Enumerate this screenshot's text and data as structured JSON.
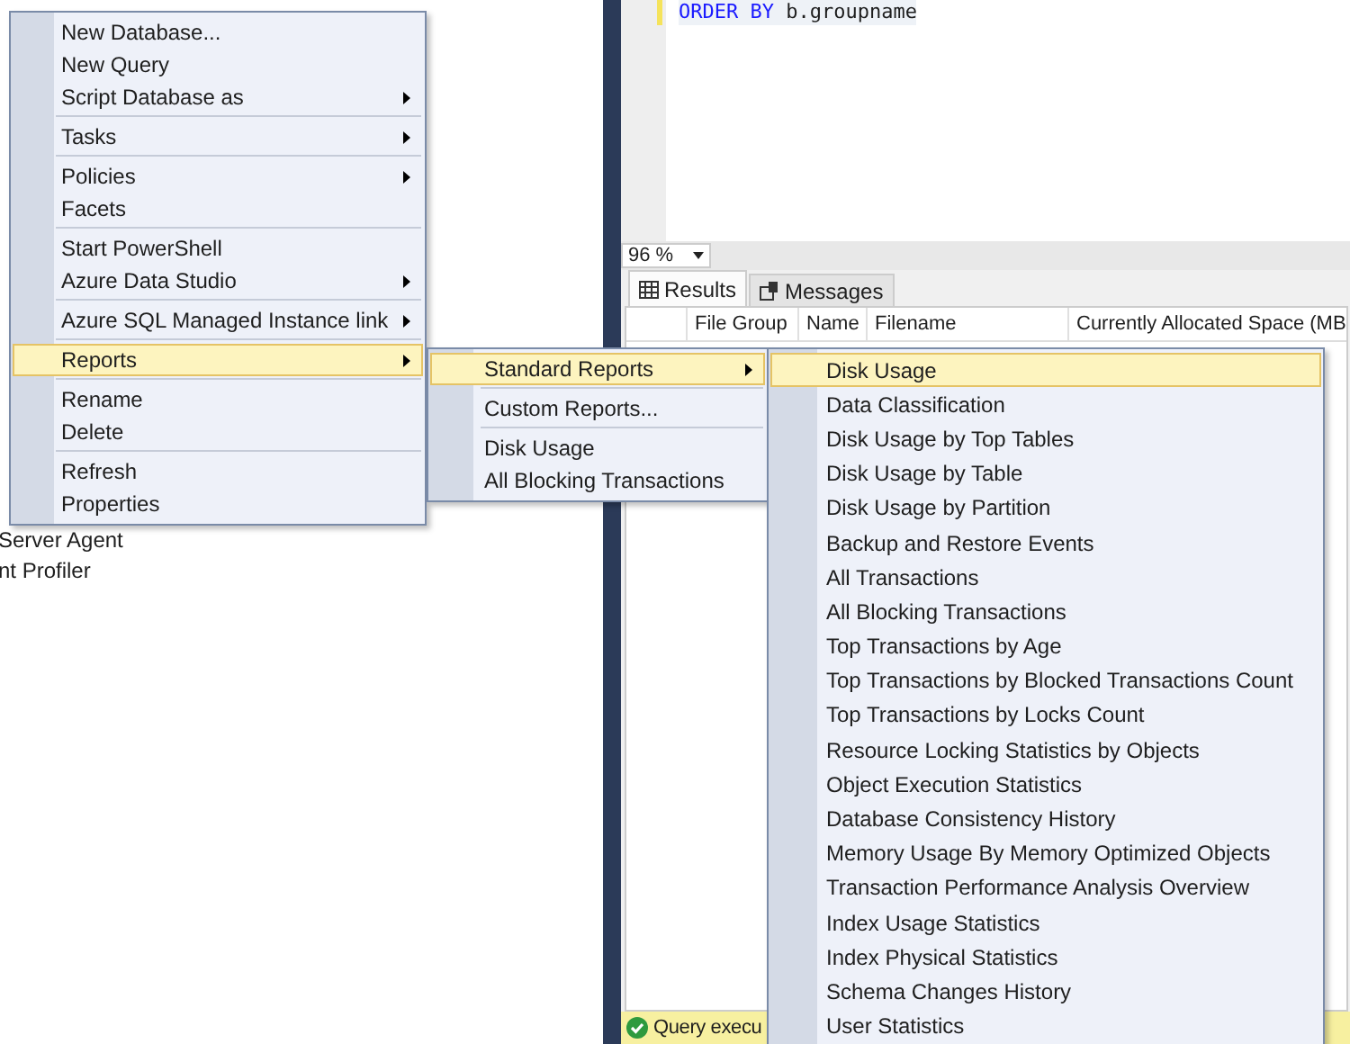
{
  "explorer": {
    "items": [
      "Server Agent",
      "nt Profiler"
    ]
  },
  "editor": {
    "keyword": "ORDER BY",
    "text": "b.groupname"
  },
  "zoom": {
    "value": "96 %"
  },
  "tabs": [
    {
      "label": "Results",
      "selected": true
    },
    {
      "label": "Messages",
      "selected": false
    }
  ],
  "grid": {
    "columns": [
      "File Group",
      "Name",
      "Filename",
      "Currently Allocated Space (MB"
    ]
  },
  "status_bar": {
    "text": "Query execu"
  },
  "context_menu": {
    "items": [
      {
        "kind": "item",
        "label": "New Database...",
        "submenu": false,
        "selected": false
      },
      {
        "kind": "item",
        "label": "New Query",
        "submenu": false,
        "selected": false
      },
      {
        "kind": "item",
        "label": "Script Database as",
        "submenu": true,
        "selected": false
      },
      {
        "kind": "separator"
      },
      {
        "kind": "item",
        "label": "Tasks",
        "submenu": true,
        "selected": false
      },
      {
        "kind": "separator"
      },
      {
        "kind": "item",
        "label": "Policies",
        "submenu": true,
        "selected": false
      },
      {
        "kind": "item",
        "label": "Facets",
        "submenu": false,
        "selected": false
      },
      {
        "kind": "separator"
      },
      {
        "kind": "item",
        "label": "Start PowerShell",
        "submenu": false,
        "selected": false
      },
      {
        "kind": "item",
        "label": "Azure Data Studio",
        "submenu": true,
        "selected": false
      },
      {
        "kind": "separator"
      },
      {
        "kind": "item",
        "label": "Azure SQL Managed Instance link",
        "submenu": true,
        "selected": false
      },
      {
        "kind": "separator"
      },
      {
        "kind": "item",
        "label": "Reports",
        "submenu": true,
        "selected": true
      },
      {
        "kind": "separator"
      },
      {
        "kind": "item",
        "label": "Rename",
        "submenu": false,
        "selected": false
      },
      {
        "kind": "item",
        "label": "Delete",
        "submenu": false,
        "selected": false
      },
      {
        "kind": "separator"
      },
      {
        "kind": "item",
        "label": "Refresh",
        "submenu": false,
        "selected": false
      },
      {
        "kind": "item",
        "label": "Properties",
        "submenu": false,
        "selected": false
      }
    ]
  },
  "reports_menu": {
    "items": [
      {
        "kind": "item",
        "label": "Standard Reports",
        "submenu": true,
        "selected": true
      },
      {
        "kind": "separator"
      },
      {
        "kind": "item",
        "label": "Custom Reports...",
        "submenu": false,
        "selected": false
      },
      {
        "kind": "separator"
      },
      {
        "kind": "item",
        "label": "Disk Usage",
        "submenu": false,
        "selected": false
      },
      {
        "kind": "item",
        "label": "All Blocking Transactions",
        "submenu": false,
        "selected": false
      }
    ]
  },
  "standard_reports_menu": {
    "items": [
      {
        "kind": "item",
        "label": "Disk Usage",
        "submenu": false,
        "selected": true
      },
      {
        "kind": "item",
        "label": "Data Classification",
        "submenu": false,
        "selected": false
      },
      {
        "kind": "item",
        "label": "Disk Usage by Top Tables",
        "submenu": false,
        "selected": false
      },
      {
        "kind": "item",
        "label": "Disk Usage by Table",
        "submenu": false,
        "selected": false
      },
      {
        "kind": "item",
        "label": "Disk Usage by Partition",
        "submenu": false,
        "selected": false
      },
      {
        "kind": "item",
        "label": "Backup and Restore Events",
        "submenu": false,
        "selected": false
      },
      {
        "kind": "item",
        "label": "All Transactions",
        "submenu": false,
        "selected": false
      },
      {
        "kind": "item",
        "label": "All Blocking Transactions",
        "submenu": false,
        "selected": false
      },
      {
        "kind": "item",
        "label": "Top Transactions by Age",
        "submenu": false,
        "selected": false
      },
      {
        "kind": "item",
        "label": "Top Transactions by Blocked Transactions Count",
        "submenu": false,
        "selected": false
      },
      {
        "kind": "item",
        "label": "Top Transactions by Locks Count",
        "submenu": false,
        "selected": false
      },
      {
        "kind": "item",
        "label": "Resource Locking Statistics by Objects",
        "submenu": false,
        "selected": false
      },
      {
        "kind": "item",
        "label": "Object Execution Statistics",
        "submenu": false,
        "selected": false
      },
      {
        "kind": "item",
        "label": "Database Consistency History",
        "submenu": false,
        "selected": false
      },
      {
        "kind": "item",
        "label": "Memory Usage By Memory Optimized Objects",
        "submenu": false,
        "selected": false
      },
      {
        "kind": "item",
        "label": "Transaction Performance Analysis Overview",
        "submenu": false,
        "selected": false
      },
      {
        "kind": "item",
        "label": "Index Usage Statistics",
        "submenu": false,
        "selected": false
      },
      {
        "kind": "item",
        "label": "Index Physical Statistics",
        "submenu": false,
        "selected": false
      },
      {
        "kind": "item",
        "label": "Schema Changes History",
        "submenu": false,
        "selected": false
      },
      {
        "kind": "item",
        "label": "User Statistics",
        "submenu": false,
        "selected": false
      }
    ]
  }
}
